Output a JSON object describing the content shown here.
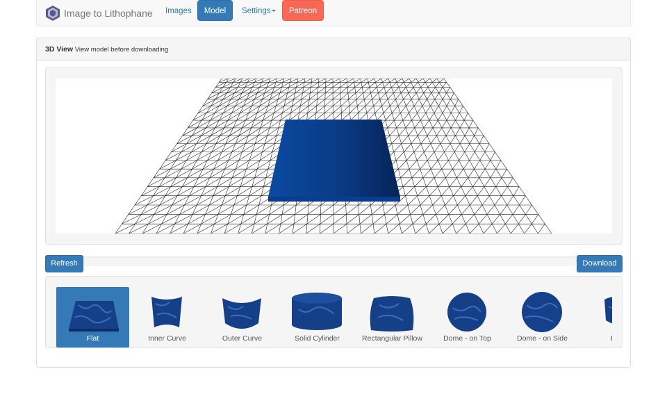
{
  "navbar": {
    "brand": "Image to Lithophane",
    "logo_icon": "hexagon-logo-icon",
    "links": {
      "images": "Images",
      "model": "Model",
      "settings": "Settings",
      "patreon": "Patreon"
    },
    "colors": {
      "primary": "#337ab7",
      "patreon": "#f96854"
    }
  },
  "panel": {
    "title": "3D View",
    "subtitle": "View model before downloading"
  },
  "viewer": {
    "model_color": "#0d3f8f",
    "grid_color": "#222222"
  },
  "actions": {
    "refresh": "Refresh",
    "download": "Download",
    "progress": 0
  },
  "shapes": {
    "items": [
      {
        "label": "Flat",
        "active": true
      },
      {
        "label": "Inner Curve",
        "active": false
      },
      {
        "label": "Outer Curve",
        "active": false
      },
      {
        "label": "Solid Cylinder",
        "active": false
      },
      {
        "label": "Rectangular Pillow",
        "active": false
      },
      {
        "label": "Dome - on Top",
        "active": false
      },
      {
        "label": "Dome - on Side",
        "active": false
      },
      {
        "label": "Hea",
        "active": false
      }
    ]
  }
}
